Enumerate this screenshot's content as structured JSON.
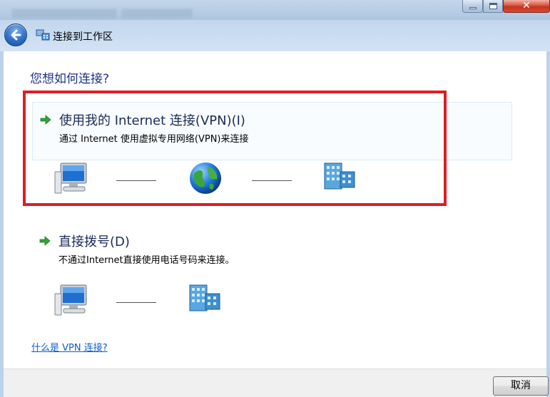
{
  "window": {
    "close_glyph": "✕",
    "controls": [
      "minimize",
      "maximize",
      "close"
    ]
  },
  "nav": {
    "back_icon": "back-arrow-icon",
    "title_icon": "network-connection-icon",
    "title": "连接到工作区"
  },
  "main": {
    "question": "您想如何连接?",
    "options": [
      {
        "title": "使用我的 Internet 连接(VPN)(I)",
        "description": "通过 Internet 使用虚拟专用网络(VPN)来连接",
        "icons": [
          "computer-icon",
          "globe-icon",
          "workplace-building-icon"
        ]
      },
      {
        "title": "直接拨号(D)",
        "description": "不通过Internet直接使用电话号码来连接。",
        "icons": [
          "computer-icon",
          "workplace-building-icon"
        ]
      }
    ],
    "help_link": "什么是 VPN 连接?"
  },
  "footer": {
    "cancel_label": "取消"
  },
  "colors": {
    "highlight": "#e01c24",
    "link": "#0a5fd1",
    "question": "#1e3287",
    "arrow": "#2fa33a"
  }
}
